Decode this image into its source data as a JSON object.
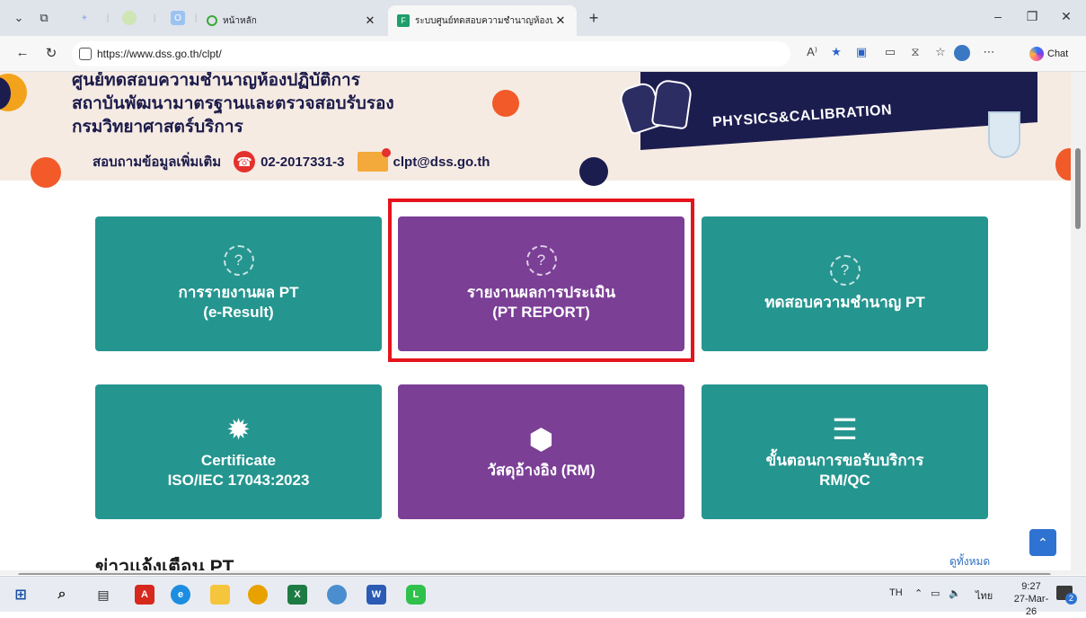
{
  "browser": {
    "tabs": [
      {
        "title": "หน้าหลัก",
        "active": false
      },
      {
        "title": "ระบบศูนย์ทดสอบความชำนาญห้องปฏิบัติ",
        "active": true
      }
    ],
    "new_tab": "+",
    "url": "https://www.dss.go.th/clpt/",
    "read_aloud": "A⁾",
    "chat_label": "Chat",
    "window_controls": {
      "minimize": "–",
      "restore": "❐",
      "close": "✕"
    }
  },
  "banner": {
    "line1": "ศูนย์ทดสอบความชำนาญห้องปฏิบัติการ",
    "line2": "สถาบันพัฒนามาตรฐานและตรวจสอบรับรอง",
    "line3": "กรมวิทยาศาสตร์บริการ",
    "contact_label": "สอบถามข้อมูลเพิ่มเติม",
    "phone": "02-2017331-3",
    "email": "clpt@dss.go.th",
    "panel_text": "PHYSICS&CALIBRATION"
  },
  "cards": [
    {
      "title": "การรายงานผล PT\n(e-Result)",
      "icon": "question-circle-icon",
      "color": "#25958f"
    },
    {
      "title": "รายงานผลการประเมิน\n(PT REPORT)",
      "icon": "question-circle-icon",
      "color": "#7b3f96"
    },
    {
      "title": "ทดสอบความชำนาญ PT",
      "icon": "question-circle-icon",
      "color": "#25958f"
    },
    {
      "title": "Certificate\nISO/IEC 17043:2023",
      "icon": "certificate-badge-icon",
      "color": "#25958f"
    },
    {
      "title": "วัสดุอ้างอิง (RM)",
      "icon": "cubes-icon",
      "color": "#7b3f96"
    },
    {
      "title": "ขั้นตอนการขอรับบริการ\nRM/QC",
      "icon": "checklist-icon",
      "color": "#25958f"
    }
  ],
  "news": {
    "title": "ข่าวแจ้งเตือน PT",
    "see_all": "ดูทั้งหมด"
  },
  "taskbar": {
    "lang": "TH",
    "input_lang": "ไทย",
    "time": "9:27",
    "date": "27-Mar-26",
    "notifications": "2"
  }
}
